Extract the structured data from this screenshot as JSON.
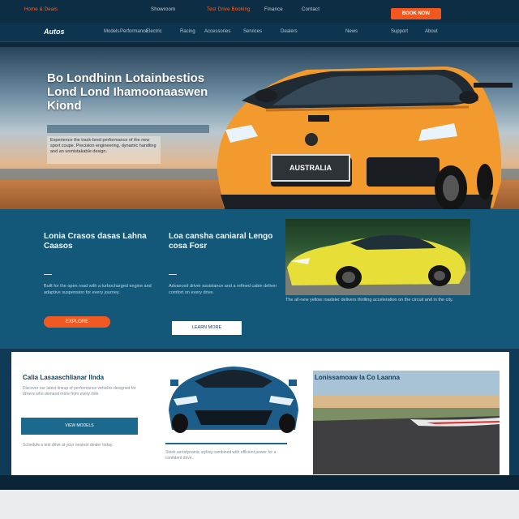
{
  "topbar": {
    "links": [
      "Home & Deals",
      "Showroom",
      "Test Drive Booking",
      "Finance",
      "Contact"
    ],
    "cta_label": "BOOK NOW"
  },
  "nav": {
    "logo": "Autos",
    "items": [
      "Models",
      "Performance",
      "Electric",
      "Racing",
      "Accessories",
      "Services",
      "Dealers",
      "News",
      "Support",
      "About"
    ]
  },
  "hero": {
    "headline": "Bo Londhinn Lotainbestios Lond Lond Ihamoonaaswen Kiond",
    "copy": "Experience the track-bred performance of the new sport coupe. Precision engineering, dynamic handling and an unmistakable design.",
    "plate": "AUSTRALIA"
  },
  "features": {
    "col1": {
      "title": "Lonia Crasos dasas Lahna Caasos",
      "text": "Built for the open road with a turbocharged engine and adaptive suspension for every journey.",
      "button": "EXPLORE"
    },
    "col2": {
      "title": "Loa cansha caniaral Lengo cosa Fosr",
      "text": "Advanced driver assistance and a refined cabin deliver comfort on every drive.",
      "button": "LEARN MORE"
    },
    "image_caption": "The all-new yellow roadster delivers thrilling acceleration on the circuit and in the city."
  },
  "cards": {
    "card1": {
      "title": "Calia Lasaaschlianar Ilnda",
      "text": "Discover our latest lineup of performance vehicles designed for drivers who demand more from every mile.",
      "button": "VIEW MODELS",
      "footer_text": "Schedule a test drive at your nearest dealer today."
    },
    "card2": {
      "text": "Sleek aerodynamic styling combined with efficient power for a confident drive."
    },
    "card3": {
      "title": "Lonissamoaw la Co Laanna"
    }
  },
  "colors": {
    "accent": "#f05a22",
    "primary": "#135878",
    "dark": "#0b2a3f",
    "hero_car": "#f39a2e",
    "feature_car": "#e7de38",
    "card_car": "#1d5d8a"
  }
}
